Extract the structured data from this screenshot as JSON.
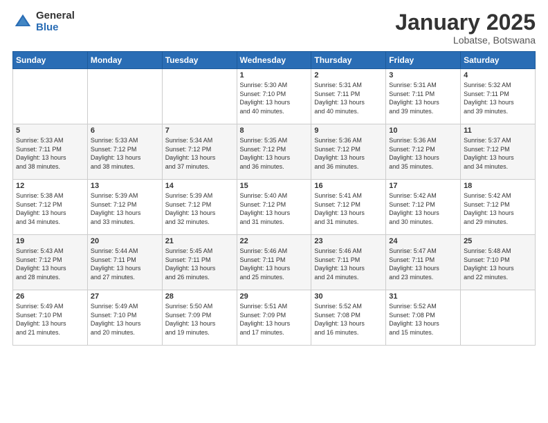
{
  "header": {
    "logo_general": "General",
    "logo_blue": "Blue",
    "month_title": "January 2025",
    "location": "Lobatse, Botswana"
  },
  "weekdays": [
    "Sunday",
    "Monday",
    "Tuesday",
    "Wednesday",
    "Thursday",
    "Friday",
    "Saturday"
  ],
  "weeks": [
    [
      {
        "day": "",
        "info": ""
      },
      {
        "day": "",
        "info": ""
      },
      {
        "day": "",
        "info": ""
      },
      {
        "day": "1",
        "info": "Sunrise: 5:30 AM\nSunset: 7:10 PM\nDaylight: 13 hours\nand 40 minutes."
      },
      {
        "day": "2",
        "info": "Sunrise: 5:31 AM\nSunset: 7:11 PM\nDaylight: 13 hours\nand 40 minutes."
      },
      {
        "day": "3",
        "info": "Sunrise: 5:31 AM\nSunset: 7:11 PM\nDaylight: 13 hours\nand 39 minutes."
      },
      {
        "day": "4",
        "info": "Sunrise: 5:32 AM\nSunset: 7:11 PM\nDaylight: 13 hours\nand 39 minutes."
      }
    ],
    [
      {
        "day": "5",
        "info": "Sunrise: 5:33 AM\nSunset: 7:11 PM\nDaylight: 13 hours\nand 38 minutes."
      },
      {
        "day": "6",
        "info": "Sunrise: 5:33 AM\nSunset: 7:12 PM\nDaylight: 13 hours\nand 38 minutes."
      },
      {
        "day": "7",
        "info": "Sunrise: 5:34 AM\nSunset: 7:12 PM\nDaylight: 13 hours\nand 37 minutes."
      },
      {
        "day": "8",
        "info": "Sunrise: 5:35 AM\nSunset: 7:12 PM\nDaylight: 13 hours\nand 36 minutes."
      },
      {
        "day": "9",
        "info": "Sunrise: 5:36 AM\nSunset: 7:12 PM\nDaylight: 13 hours\nand 36 minutes."
      },
      {
        "day": "10",
        "info": "Sunrise: 5:36 AM\nSunset: 7:12 PM\nDaylight: 13 hours\nand 35 minutes."
      },
      {
        "day": "11",
        "info": "Sunrise: 5:37 AM\nSunset: 7:12 PM\nDaylight: 13 hours\nand 34 minutes."
      }
    ],
    [
      {
        "day": "12",
        "info": "Sunrise: 5:38 AM\nSunset: 7:12 PM\nDaylight: 13 hours\nand 34 minutes."
      },
      {
        "day": "13",
        "info": "Sunrise: 5:39 AM\nSunset: 7:12 PM\nDaylight: 13 hours\nand 33 minutes."
      },
      {
        "day": "14",
        "info": "Sunrise: 5:39 AM\nSunset: 7:12 PM\nDaylight: 13 hours\nand 32 minutes."
      },
      {
        "day": "15",
        "info": "Sunrise: 5:40 AM\nSunset: 7:12 PM\nDaylight: 13 hours\nand 31 minutes."
      },
      {
        "day": "16",
        "info": "Sunrise: 5:41 AM\nSunset: 7:12 PM\nDaylight: 13 hours\nand 31 minutes."
      },
      {
        "day": "17",
        "info": "Sunrise: 5:42 AM\nSunset: 7:12 PM\nDaylight: 13 hours\nand 30 minutes."
      },
      {
        "day": "18",
        "info": "Sunrise: 5:42 AM\nSunset: 7:12 PM\nDaylight: 13 hours\nand 29 minutes."
      }
    ],
    [
      {
        "day": "19",
        "info": "Sunrise: 5:43 AM\nSunset: 7:12 PM\nDaylight: 13 hours\nand 28 minutes."
      },
      {
        "day": "20",
        "info": "Sunrise: 5:44 AM\nSunset: 7:11 PM\nDaylight: 13 hours\nand 27 minutes."
      },
      {
        "day": "21",
        "info": "Sunrise: 5:45 AM\nSunset: 7:11 PM\nDaylight: 13 hours\nand 26 minutes."
      },
      {
        "day": "22",
        "info": "Sunrise: 5:46 AM\nSunset: 7:11 PM\nDaylight: 13 hours\nand 25 minutes."
      },
      {
        "day": "23",
        "info": "Sunrise: 5:46 AM\nSunset: 7:11 PM\nDaylight: 13 hours\nand 24 minutes."
      },
      {
        "day": "24",
        "info": "Sunrise: 5:47 AM\nSunset: 7:11 PM\nDaylight: 13 hours\nand 23 minutes."
      },
      {
        "day": "25",
        "info": "Sunrise: 5:48 AM\nSunset: 7:10 PM\nDaylight: 13 hours\nand 22 minutes."
      }
    ],
    [
      {
        "day": "26",
        "info": "Sunrise: 5:49 AM\nSunset: 7:10 PM\nDaylight: 13 hours\nand 21 minutes."
      },
      {
        "day": "27",
        "info": "Sunrise: 5:49 AM\nSunset: 7:10 PM\nDaylight: 13 hours\nand 20 minutes."
      },
      {
        "day": "28",
        "info": "Sunrise: 5:50 AM\nSunset: 7:09 PM\nDaylight: 13 hours\nand 19 minutes."
      },
      {
        "day": "29",
        "info": "Sunrise: 5:51 AM\nSunset: 7:09 PM\nDaylight: 13 hours\nand 17 minutes."
      },
      {
        "day": "30",
        "info": "Sunrise: 5:52 AM\nSunset: 7:08 PM\nDaylight: 13 hours\nand 16 minutes."
      },
      {
        "day": "31",
        "info": "Sunrise: 5:52 AM\nSunset: 7:08 PM\nDaylight: 13 hours\nand 15 minutes."
      },
      {
        "day": "",
        "info": ""
      }
    ]
  ]
}
